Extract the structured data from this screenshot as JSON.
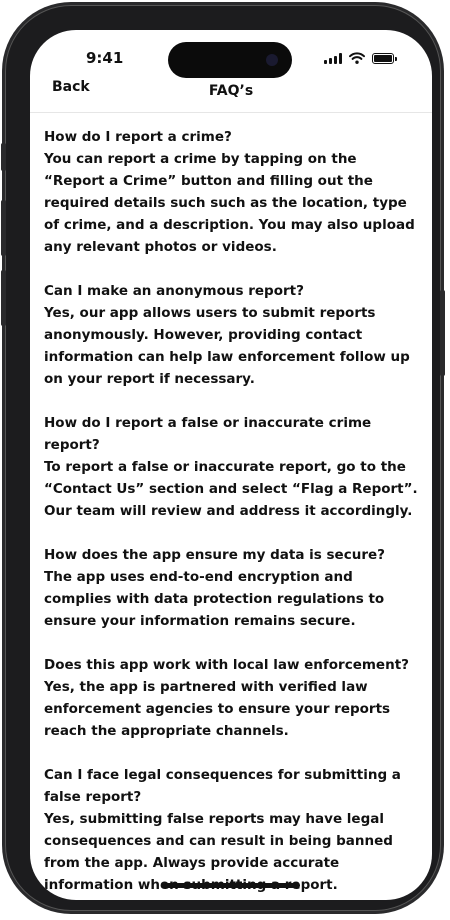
{
  "status_bar": {
    "time": "9:41"
  },
  "nav": {
    "back_label": "Back",
    "title": "FAQ’s"
  },
  "faqs": [
    {
      "question": "How do I report a crime?",
      "answer": "You can report a crime by tapping on the “Report  a Crime” button and filling out the required details such such as the location, type of crime, and a description. You may also upload any relevant photos or videos."
    },
    {
      "question": "Can I make an anonymous report?",
      "answer": "Yes, our app allows users to submit reports anonymously. However, providing contact information can help law enforcement follow up on your report if necessary."
    },
    {
      "question": "How do I report a false or inaccurate crime report?",
      "answer": "To report a false or inaccurate report, go to the “Contact Us” section and select “Flag a Report”. Our team will review and address it accordingly."
    },
    {
      "question": "How does the app ensure my data is secure?",
      "answer": "The app uses end-to-end encryption and complies with data protection regulations to ensure your information remains secure."
    },
    {
      "question": "Does this app work with local law enforcement?",
      "answer": "Yes, the app is partnered with verified law enforcement agencies to ensure your reports reach the appropriate channels."
    },
    {
      "question": "Can I face legal consequences for submitting a false report?",
      "answer": "Yes, submitting false reports may have legal consequences and can result in being banned from the app. Always provide accurate information when   submitting a report."
    }
  ],
  "icons": {
    "signal": "cellular-signal-icon",
    "wifi": "wifi-icon",
    "battery": "battery-icon"
  }
}
